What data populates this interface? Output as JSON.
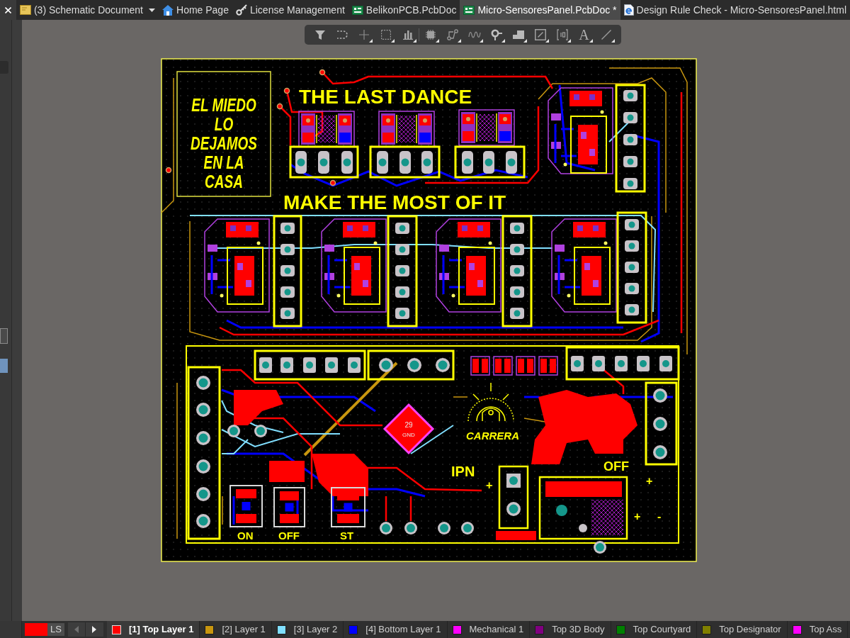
{
  "tabs": [
    {
      "label": "(3) Schematic Document",
      "kind": "schematic",
      "dropdown": true,
      "selected": false
    },
    {
      "label": "Home Page",
      "kind": "home",
      "dropdown": false,
      "selected": false
    },
    {
      "label": "License Management",
      "kind": "license",
      "dropdown": false,
      "selected": false
    },
    {
      "label": "BelikonPCB.PcbDoc",
      "kind": "pcb",
      "dropdown": false,
      "selected": false
    },
    {
      "label": "Micro-SensoresPanel.PcbDoc *",
      "kind": "pcb",
      "dropdown": false,
      "selected": true
    },
    {
      "label": "Design Rule Check - Micro-SensoresPanel.html",
      "kind": "report",
      "dropdown": false,
      "selected": false
    }
  ],
  "toolbar": [
    {
      "kind": "filter",
      "menu": false
    },
    {
      "kind": "connect",
      "menu": false
    },
    {
      "kind": "cross",
      "menu": true
    },
    {
      "kind": "select",
      "menu": true
    },
    {
      "kind": "align",
      "menu": true
    },
    {
      "kind": "component",
      "menu": true
    },
    {
      "kind": "route",
      "menu": true
    },
    {
      "kind": "tune",
      "menu": true
    },
    {
      "kind": "via",
      "menu": true
    },
    {
      "kind": "fill",
      "menu": true
    },
    {
      "kind": "dimension",
      "menu": true
    },
    {
      "kind": "designator",
      "menu": true
    },
    {
      "kind": "text",
      "label": "A",
      "menu": true
    },
    {
      "kind": "line",
      "menu": true
    }
  ],
  "board": {
    "frame_text": [
      "EL MIEDO",
      "LO",
      "DEJAMOS",
      "EN LA",
      "CASA"
    ],
    "title": "THE LAST DANCE",
    "motto": "MAKE THE MOST OF IT",
    "logo_text": "CARRERA",
    "chip_text": [
      "29",
      "GND"
    ],
    "labels": [
      "IPN",
      "OFF",
      "ON",
      "OFF",
      "ST",
      "+",
      "+",
      "+",
      "-"
    ]
  },
  "layer_bar": {
    "set_label": "LS",
    "prev_disabled": true,
    "next_disabled": false,
    "layers": [
      {
        "label": "[1] Top Layer 1",
        "color": "#ff0000",
        "selected": true
      },
      {
        "label": "[2] Layer 1",
        "color": "#c8960f",
        "selected": false
      },
      {
        "label": "[3] Layer 2",
        "color": "#80dfff",
        "selected": false
      },
      {
        "label": "[4] Bottom Layer 1",
        "color": "#0000ff",
        "selected": false
      },
      {
        "label": "Mechanical 1",
        "color": "#ff00ff",
        "selected": false
      },
      {
        "label": "Top 3D Body",
        "color": "#800080",
        "selected": false
      },
      {
        "label": "Top Courtyard",
        "color": "#008000",
        "selected": false
      },
      {
        "label": "Top Designator",
        "color": "#808000",
        "selected": false
      },
      {
        "label": "Top Ass",
        "color": "#ff00ff",
        "selected": false
      }
    ]
  }
}
